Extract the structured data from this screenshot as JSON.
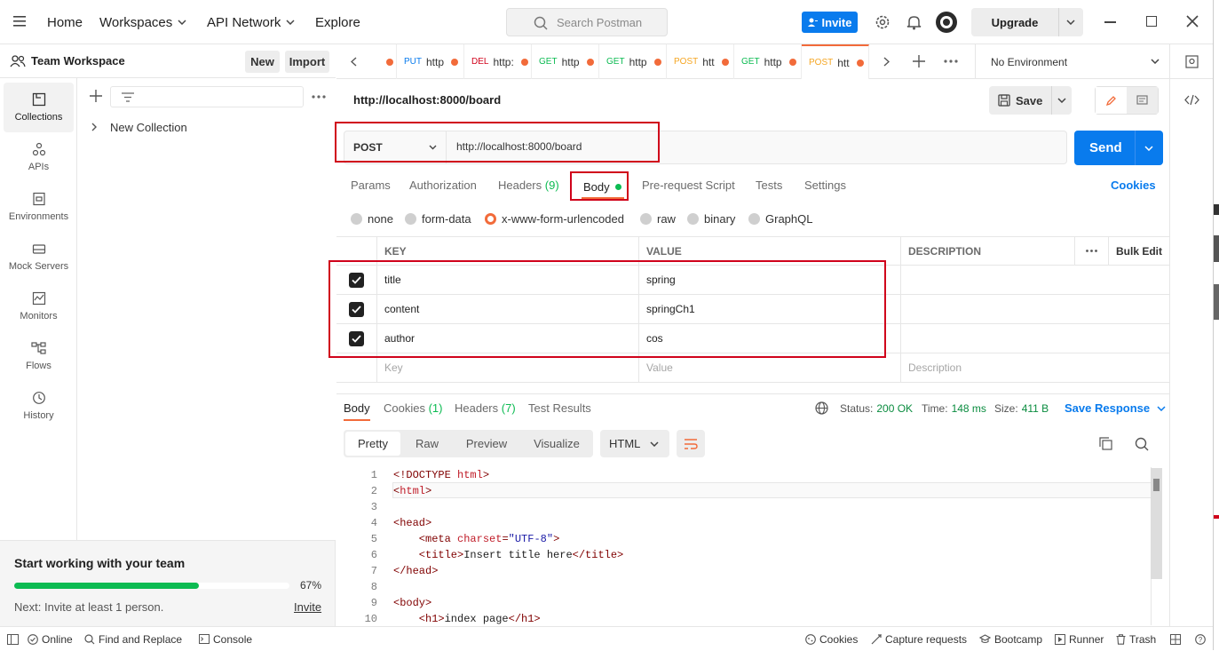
{
  "topnav": {
    "home": "Home",
    "workspaces": "Workspaces",
    "api_network": "API Network",
    "explore": "Explore"
  },
  "search": {
    "placeholder": "Search Postman"
  },
  "invite_label": "Invite",
  "upgrade_label": "Upgrade",
  "workspace": {
    "name": "Team Workspace",
    "new_label": "New",
    "import_label": "Import"
  },
  "rail": [
    {
      "label": "Collections",
      "icon": "collections-icon"
    },
    {
      "label": "APIs",
      "icon": "apis-icon"
    },
    {
      "label": "Environments",
      "icon": "environments-icon"
    },
    {
      "label": "Mock Servers",
      "icon": "mock-servers-icon"
    },
    {
      "label": "Monitors",
      "icon": "monitors-icon"
    },
    {
      "label": "Flows",
      "icon": "flows-icon"
    },
    {
      "label": "History",
      "icon": "history-icon"
    }
  ],
  "collections": [
    {
      "label": "New Collection"
    }
  ],
  "team_card": {
    "title": "Start working with your team",
    "progress_text": "67%",
    "progress_value": 0.67,
    "next": "Next: Invite at least 1 person.",
    "invite_link": "Invite"
  },
  "tabs": [
    {
      "method": "",
      "url": "",
      "color": "#f26b3a"
    },
    {
      "method": "PUT",
      "url": "http",
      "color": "#097bed"
    },
    {
      "method": "DEL",
      "url": "http:",
      "color": "#d0021b"
    },
    {
      "method": "GET",
      "url": "http",
      "color": "#0cbb52"
    },
    {
      "method": "GET",
      "url": "http",
      "color": "#0cbb52"
    },
    {
      "method": "POST",
      "url": "htt",
      "color": "#f5a623"
    },
    {
      "method": "GET",
      "url": "http",
      "color": "#0cbb52"
    },
    {
      "method": "POST",
      "url": "htt",
      "color": "#f5a623"
    }
  ],
  "environment": "No Environment",
  "request": {
    "title": "http://localhost:8000/board",
    "save_label": "Save",
    "method": "POST",
    "url": "http://localhost:8000/board",
    "send_label": "Send",
    "tabs": {
      "params": "Params",
      "authorization": "Authorization",
      "headers": "Headers",
      "headers_count": "(9)",
      "body": "Body",
      "prerequest": "Pre-request Script",
      "tests": "Tests",
      "settings": "Settings"
    },
    "cookies_label": "Cookies",
    "body_types": [
      "none",
      "form-data",
      "x-www-form-urlencoded",
      "raw",
      "binary",
      "GraphQL"
    ],
    "selected_body_type": "x-www-form-urlencoded"
  },
  "table": {
    "headers": {
      "key": "KEY",
      "value": "VALUE",
      "description": "DESCRIPTION",
      "bulk_edit": "Bulk Edit"
    },
    "rows": [
      {
        "key": "title",
        "value": "spring",
        "checked": true
      },
      {
        "key": "content",
        "value": "springCh1",
        "checked": true
      },
      {
        "key": "author",
        "value": "cos",
        "checked": true
      }
    ],
    "placeholders": {
      "key": "Key",
      "value": "Value",
      "description": "Description"
    }
  },
  "response": {
    "tabs": {
      "body": "Body",
      "cookies": "Cookies",
      "cookies_count": "(1)",
      "headers": "Headers",
      "headers_count": "(7)",
      "tests": "Test Results"
    },
    "status_label": "Status:",
    "status_value": "200 OK",
    "time_label": "Time:",
    "time_value": "148 ms",
    "size_label": "Size:",
    "size_value": "411 B",
    "save_response": "Save Response",
    "views": [
      "Pretty",
      "Raw",
      "Preview",
      "Visualize"
    ],
    "format": "HTML",
    "code": [
      {
        "n": "1",
        "t": "<!DOCTYPE html>"
      },
      {
        "n": "2",
        "t": "<html>"
      },
      {
        "n": "3",
        "t": ""
      },
      {
        "n": "4",
        "t": "<head>"
      },
      {
        "n": "5",
        "t": "    <meta charset=\"UTF-8\">"
      },
      {
        "n": "6",
        "t": "    <title>Insert title here</title>"
      },
      {
        "n": "7",
        "t": "</head>"
      },
      {
        "n": "8",
        "t": ""
      },
      {
        "n": "9",
        "t": "<body>"
      },
      {
        "n": "10",
        "t": "    <h1>index page</h1>"
      }
    ]
  },
  "statusbar": {
    "online": "Online",
    "find_replace": "Find and Replace",
    "console": "Console",
    "cookies": "Cookies",
    "capture": "Capture requests",
    "bootcamp": "Bootcamp",
    "runner": "Runner",
    "trash": "Trash"
  }
}
